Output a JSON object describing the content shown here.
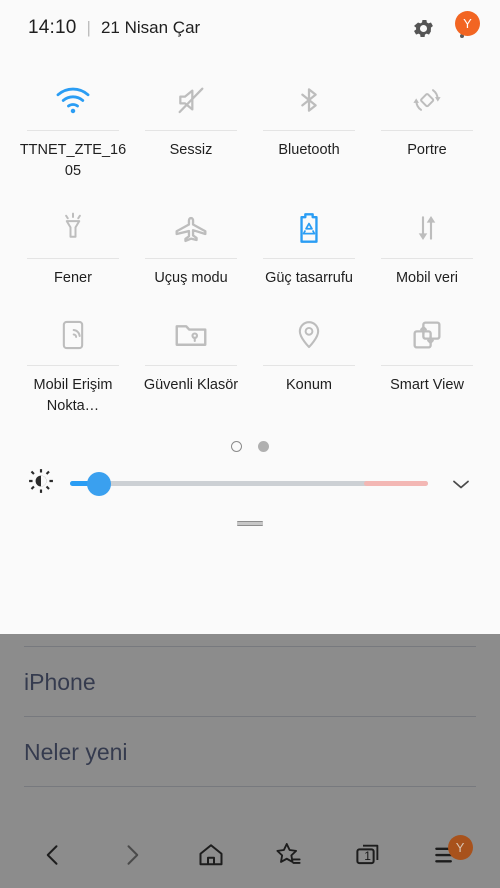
{
  "statusbar": {
    "time": "14:10",
    "separator": "|",
    "date": "21 Nisan Çar",
    "settings_icon": "gear-icon",
    "menu_icon": "kebab-menu-icon",
    "avatar_initial": "Y",
    "avatar_color": "#f26522"
  },
  "quick_settings": {
    "active_color": "#2a9df4",
    "inactive_color": "#b9b9b9",
    "tiles": [
      {
        "id": "wifi",
        "label": "TTNET_ZTE_1605",
        "icon": "wifi-icon",
        "active": true
      },
      {
        "id": "sound",
        "label": "Sessiz",
        "icon": "mute-icon",
        "active": false
      },
      {
        "id": "bluetooth",
        "label": "Bluetooth",
        "icon": "bluetooth-icon",
        "active": false
      },
      {
        "id": "rotation",
        "label": "Portre",
        "icon": "auto-rotate-icon",
        "active": false
      },
      {
        "id": "flashlight",
        "label": "Fener",
        "icon": "flashlight-icon",
        "active": false
      },
      {
        "id": "airplane",
        "label": "Uçuş modu",
        "icon": "airplane-icon",
        "active": false
      },
      {
        "id": "powersave",
        "label": "Güç tasarrufu",
        "icon": "power-saving-icon",
        "active": true
      },
      {
        "id": "mobiledata",
        "label": "Mobil veri",
        "icon": "mobile-data-icon",
        "active": false
      },
      {
        "id": "hotspot",
        "label": "Mobil Erişim Nokta…",
        "icon": "hotspot-icon",
        "active": false
      },
      {
        "id": "securefolder",
        "label": "Güvenli Klasör",
        "icon": "secure-folder-icon",
        "active": false
      },
      {
        "id": "location",
        "label": "Konum",
        "icon": "location-pin-icon",
        "active": false
      },
      {
        "id": "smartview",
        "label": "Smart View",
        "icon": "smart-view-icon",
        "active": false
      }
    ],
    "pages": {
      "count": 2,
      "current": 1
    },
    "brightness": {
      "icon": "brightness-icon",
      "value": 8,
      "expand_icon": "chevron-down-icon"
    },
    "drag_handle": "panel-drag-handle"
  },
  "background_page": {
    "links": [
      "iPhone",
      "Neler yeni"
    ]
  },
  "navbar": {
    "buttons": [
      {
        "id": "back",
        "icon": "chevron-left-icon"
      },
      {
        "id": "forward",
        "icon": "chevron-right-icon"
      },
      {
        "id": "home",
        "icon": "home-icon"
      },
      {
        "id": "bookmarks",
        "icon": "bookmark-star-icon"
      },
      {
        "id": "tabs",
        "icon": "tabs-icon",
        "count": "1"
      },
      {
        "id": "menu",
        "icon": "hamburger-menu-icon",
        "badge": "Y"
      }
    ]
  }
}
